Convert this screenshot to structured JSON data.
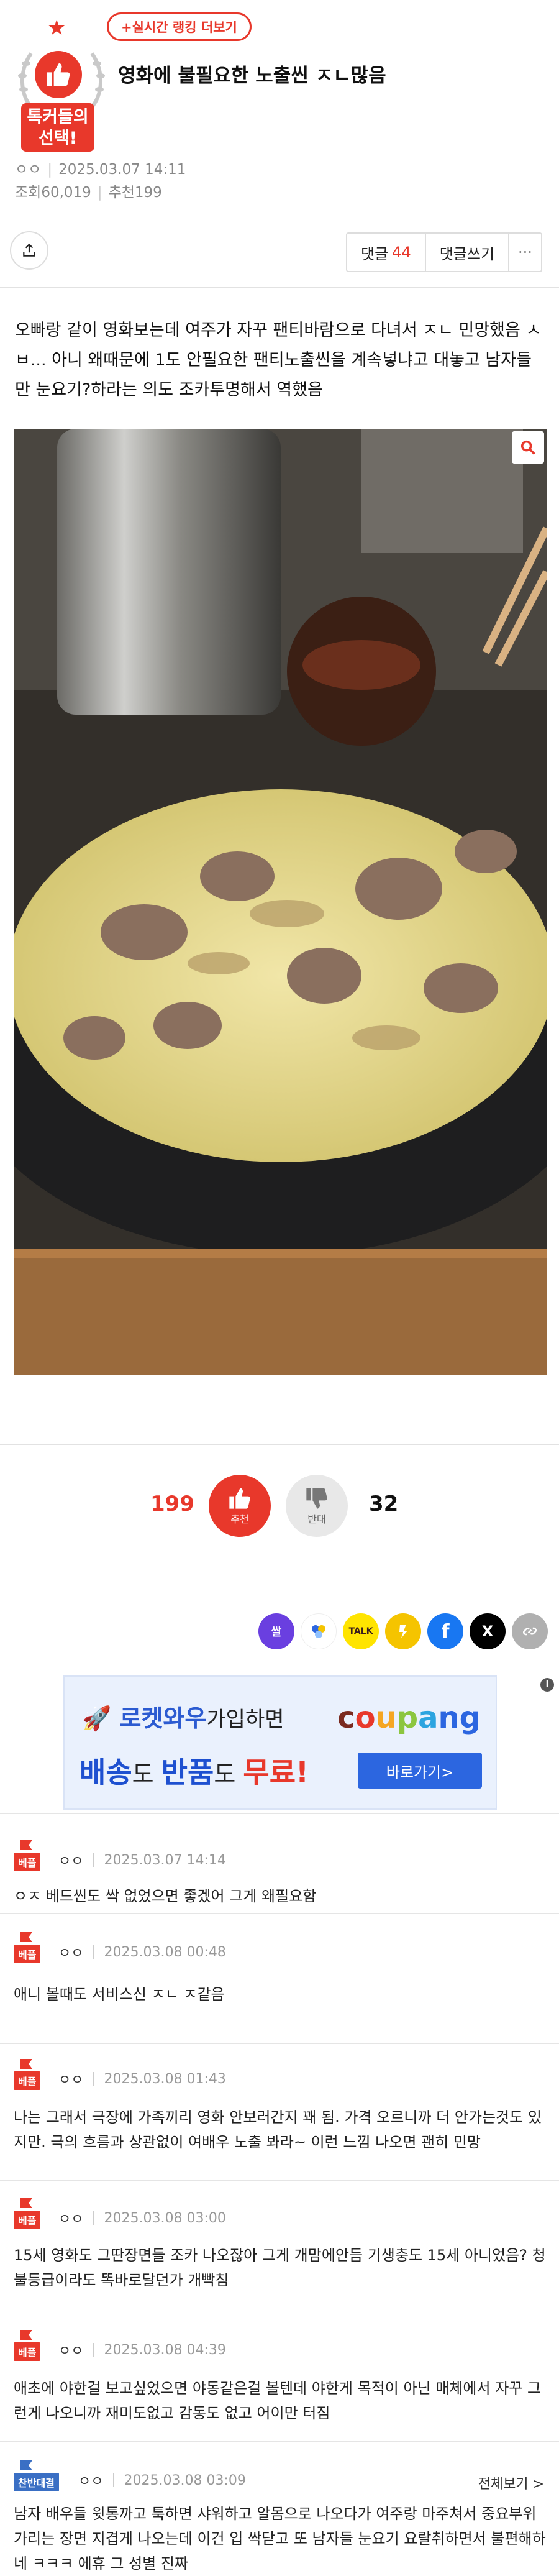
{
  "post": {
    "badge_text": "톡커들의 선택!",
    "rank_link": "+실시간 랭킹 더보기",
    "title": "영화에 불필요한 노출씬 ㅈㄴ많음",
    "author": "ㅇㅇ",
    "datetime": "2025.03.07 14:11",
    "views_label": "조회",
    "views": "60,019",
    "recommend_label": "추천",
    "recommend": "199",
    "body": "오빠랑 같이 영화보는데 여주가 자꾸 팬티바람으로 다녀서 ㅈㄴ 민망했음 ㅅㅂ... 아니 왜때문에 1도 안필요한 팬티노출씬을 계속넣냐고 대놓고 남자들만 눈요기?하라는 의도 조카투명해서 역했음"
  },
  "actions": {
    "comment_label": "댓글",
    "comment_count": "44",
    "write_comment": "댓글쓰기",
    "more": "···"
  },
  "votes": {
    "up_count": "199",
    "up_label": "추천",
    "down_count": "32",
    "down_label": "반대"
  },
  "sns": [
    {
      "name": "say-icon",
      "label": "쌀",
      "color": "#6a3fe0"
    },
    {
      "name": "dots-icon",
      "label": "",
      "color": "#ffffff"
    },
    {
      "name": "talk-icon",
      "label": "TALK",
      "color": "#ffe400"
    },
    {
      "name": "kakaostory-icon",
      "label": "",
      "color": "#f5c400"
    },
    {
      "name": "facebook-icon",
      "label": "f",
      "color": "#1877f2"
    },
    {
      "name": "x-icon",
      "label": "X",
      "color": "#000000"
    },
    {
      "name": "link-icon",
      "label": "",
      "color": "#b0b0b0"
    }
  ],
  "ad": {
    "line1_brand": "로켓와우",
    "line1_rest": "가입하면",
    "line2_a": "배송",
    "line2_b": "도 ",
    "line2_c": "반품",
    "line2_d": "도 ",
    "line2_e": "무료!",
    "brand": "coupang",
    "button": "바로가기>",
    "info": "i"
  },
  "comments": [
    {
      "type": "best",
      "badge": "베플",
      "nick": "ㅇㅇ",
      "date": "2025.03.07 14:14",
      "text": "ㅇㅈ 베드씬도 싹 없었으면 좋겠어 그게 왜필요함"
    },
    {
      "type": "best",
      "badge": "베플",
      "nick": "ㅇㅇ",
      "date": "2025.03.08 00:48",
      "text": "애니 볼때도 서비스신 ㅈㄴ ㅈ같음"
    },
    {
      "type": "best",
      "badge": "베플",
      "nick": "ㅇㅇ",
      "date": "2025.03.08 01:43",
      "text": "나는 그래서 극장에 가족끼리 영화 안보러간지 꽤 됨. 가격 오르니까 더 안가는것도 있지만. 극의 흐름과 상관없이 여배우 노출 봐라~ 이런 느낌 나오면 괜히 민망"
    },
    {
      "type": "best",
      "badge": "베플",
      "nick": "ㅇㅇ",
      "date": "2025.03.08 03:00",
      "text": "15세 영화도 그딴장면들 조카 나오잖아 그게 개맘에안듬 기생충도 15세 아니었음? 청불등급이라도 똑바로달던가 개빡침"
    },
    {
      "type": "best",
      "badge": "베플",
      "nick": "ㅇㅇ",
      "date": "2025.03.08 04:39",
      "text": "애초에 야한걸 보고싶었으면 야동같은걸 볼텐데 야한게 목적이 아닌 매체에서 자꾸 그런게 나오니까 재미도없고 감동도 없고 어이만 터짐"
    },
    {
      "type": "opposite",
      "badge": "찬반대결",
      "nick": "ㅇㅇ",
      "date": "2025.03.08 03:09",
      "more": "전체보기 >",
      "text": "남자 배우들 윗통까고 툭하면 샤워하고 알몸으로 나오다가 여주랑 마주쳐서 중요부위 가리는 장면 지겹게 나오는데 이건 입 싹닫고 또 남자들 눈요기 요랄취하면서 불편해하네 ㅋㅋㅋ 에휴 그 성별 진짜"
    }
  ]
}
